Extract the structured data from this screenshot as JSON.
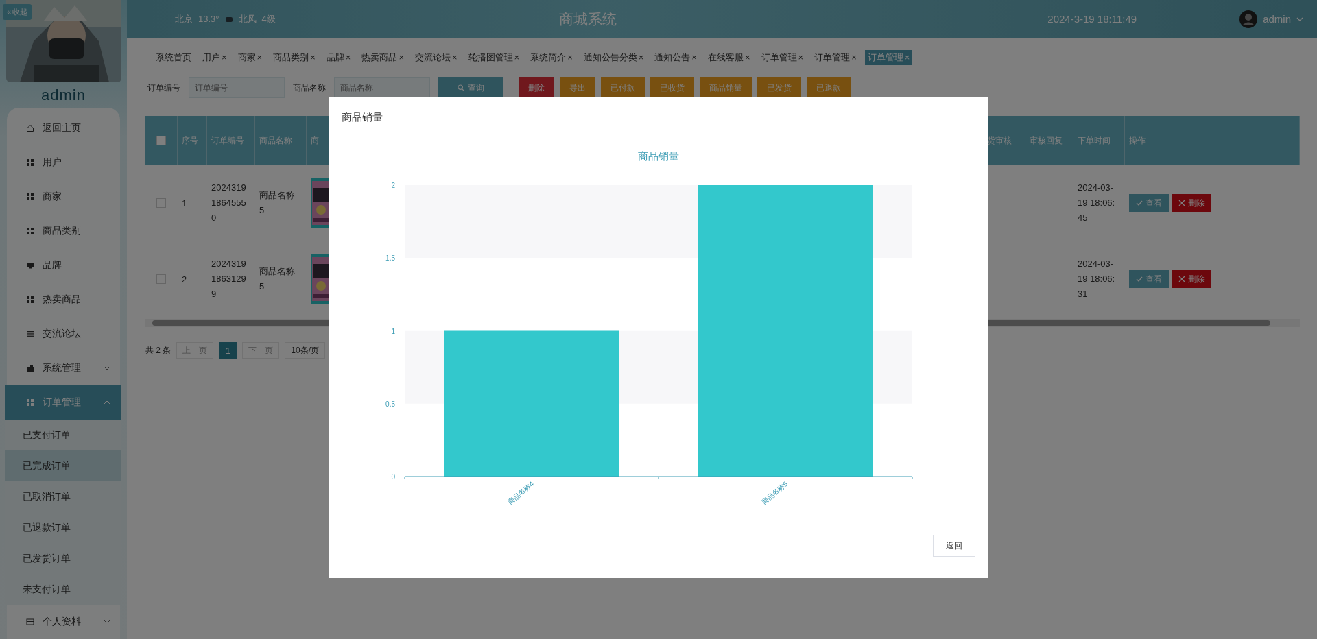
{
  "header": {
    "collapse_icon": "«",
    "collapse_button": "收起",
    "weather": {
      "city": "北京",
      "temperature": "13.3°",
      "wind": "北风",
      "wind_level": "4级"
    },
    "title": "商城系统",
    "datetime": "2024-3-19 18:11:49",
    "user": "admin"
  },
  "sidebar": {
    "user": "admin",
    "items": [
      {
        "label": "返回主页",
        "selected": false
      },
      {
        "label": "用户",
        "selected": false
      },
      {
        "label": "商家",
        "selected": false
      },
      {
        "label": "商品类别",
        "selected": false
      },
      {
        "label": "品牌",
        "selected": false
      },
      {
        "label": "热卖商品",
        "selected": false
      },
      {
        "label": "交流论坛",
        "selected": false
      },
      {
        "label": "系统管理",
        "selected": false,
        "expanded": false
      },
      {
        "label": "订单管理",
        "selected": true,
        "expanded": true,
        "children": [
          {
            "label": "已支付订单",
            "selected": false
          },
          {
            "label": "已完成订单",
            "selected": true
          },
          {
            "label": "已取消订单",
            "selected": false
          },
          {
            "label": "已退款订单",
            "selected": false
          },
          {
            "label": "已发货订单",
            "selected": false
          },
          {
            "label": "未支付订单",
            "selected": false
          }
        ]
      },
      {
        "label": "个人资料",
        "selected": false,
        "expanded": false
      }
    ]
  },
  "tabs": [
    {
      "label": "系统首页",
      "selected": false
    },
    {
      "label": "用户",
      "close": "×",
      "selected": false
    },
    {
      "label": "商家",
      "close": "×",
      "selected": false
    },
    {
      "label": "商品类别",
      "close": "×",
      "selected": false
    },
    {
      "label": "品牌",
      "close": "×",
      "selected": false
    },
    {
      "label": "热卖商品",
      "close": "×",
      "selected": false
    },
    {
      "label": "交流论坛",
      "close": "×",
      "selected": false
    },
    {
      "label": "轮播图管理",
      "close": "×",
      "selected": false
    },
    {
      "label": "系统简介",
      "close": "×",
      "selected": false
    },
    {
      "label": "通知公告分类",
      "close": "×",
      "selected": false
    },
    {
      "label": "通知公告",
      "close": "×",
      "selected": false
    },
    {
      "label": "在线客服",
      "close": "×",
      "selected": false
    },
    {
      "label": "订单管理",
      "close": "×",
      "selected": false
    },
    {
      "label": "订单管理",
      "close": "×",
      "selected": false
    },
    {
      "label": "订单管理",
      "close": "×",
      "selected": true
    }
  ],
  "search": {
    "fields": [
      {
        "label": "订单编号",
        "placeholder": "订单编号"
      },
      {
        "label": "商品名称",
        "placeholder": "商品名称"
      }
    ],
    "button": "查询"
  },
  "toolbar": [
    {
      "label": "删除",
      "kind": "danger"
    },
    {
      "label": "导出",
      "kind": "warning"
    },
    {
      "label": "已付款",
      "kind": "warning"
    },
    {
      "label": "已收货",
      "kind": "warning"
    },
    {
      "label": "商品销量",
      "kind": "warning"
    },
    {
      "label": "已发货",
      "kind": "warning"
    },
    {
      "label": "已退款",
      "kind": "warning"
    }
  ],
  "table": {
    "header_checked": false,
    "left_columns": [
      "序号",
      "订单编号",
      "商品名称",
      "商"
    ],
    "right_columns": [
      "货审核",
      "审核回复",
      "下单时间",
      "操作"
    ],
    "rows": [
      {
        "checked": false,
        "index": "1",
        "order_no": "202431918645550",
        "product": "商品名称5",
        "created": "2024-03-19 18:06:45",
        "actions": [
          "查看",
          "删除"
        ]
      },
      {
        "checked": false,
        "index": "2",
        "order_no": "202431918631299",
        "product": "商品名称5",
        "created": "2024-03-19 18:06:31",
        "actions": [
          "查看",
          "删除"
        ]
      }
    ]
  },
  "pagination": {
    "total": "共 2 条",
    "prev": "上一页",
    "pages": [
      {
        "label": "1",
        "selected": true
      }
    ],
    "next": "下一页",
    "page_size": "10条/页"
  },
  "dialog": {
    "title": "商品销量",
    "close_button": "返回",
    "chart_data": {
      "type": "bar",
      "title": "商品销量",
      "categories": [
        "商品名称4",
        "商品名称5"
      ],
      "series": [
        {
          "color": "#33c8cc",
          "values": [
            1,
            2
          ]
        }
      ],
      "ylim": [
        0,
        2
      ],
      "yticks": [
        0,
        0.5,
        1,
        1.5,
        2
      ]
    }
  }
}
